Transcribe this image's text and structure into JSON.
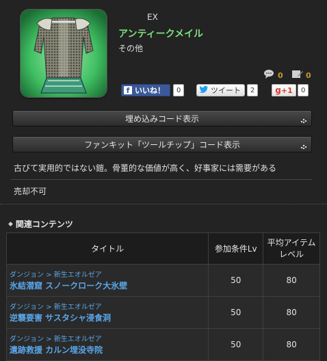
{
  "item": {
    "tag": "EX",
    "name": "アンティークメイル",
    "category": "その他",
    "comment_count": "0",
    "edit_count": "0"
  },
  "social": {
    "like_label": "いいね！",
    "like_count": "0",
    "tweet_label": "ツイート",
    "tweet_count": "2",
    "gplus_label": "+1",
    "gplus_count": "0"
  },
  "buttons": {
    "embed": "埋め込みコード表示",
    "fankit": "ファンキット「ツールチップ」コード表示"
  },
  "description": "古びて実用的ではない鎧。骨董的な価値が高く、好事家には需要がある",
  "sell": "売却不可",
  "related": {
    "heading": "関連コンテンツ",
    "columns": [
      "タイトル",
      "参加条件Lv",
      "平均アイテム\nレベル"
    ],
    "rows": [
      {
        "type": "ダンジョン",
        "sep": ">",
        "region": "新生エオルゼア",
        "name": "氷結潜窟 スノークローク大氷壁",
        "level": "50",
        "ilvl": "80"
      },
      {
        "type": "ダンジョン",
        "sep": ">",
        "region": "新生エオルゼア",
        "name": "逆襲要害 サスタシャ浸食洞",
        "level": "50",
        "ilvl": "80"
      },
      {
        "type": "ダンジョン",
        "sep": ">",
        "region": "新生エオルゼア",
        "name": "遺跡救援 カルン埋没寺院",
        "level": "50",
        "ilvl": "80"
      }
    ]
  },
  "colors": {
    "item_name": "#7ee07e",
    "link": "#59a6e8",
    "counter": "#c79a2a"
  }
}
